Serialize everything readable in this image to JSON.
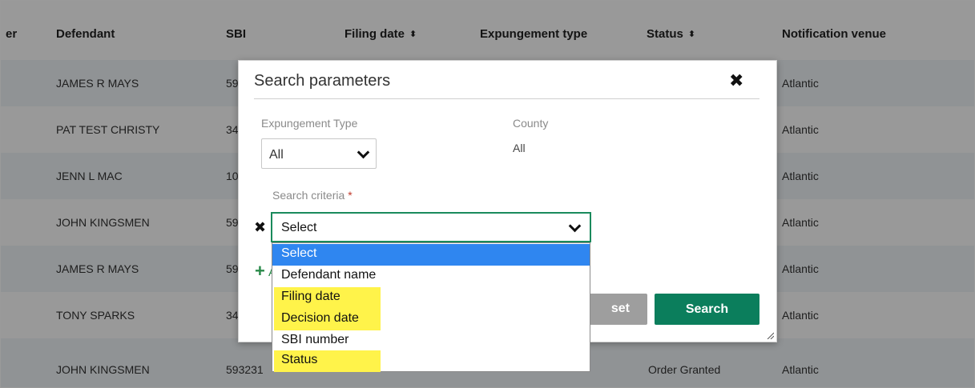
{
  "table": {
    "headers": [
      {
        "label": "er",
        "sortable": false
      },
      {
        "label": "Defendant",
        "sortable": false
      },
      {
        "label": "SBI",
        "sortable": false
      },
      {
        "label": "Filing date",
        "sortable": true
      },
      {
        "label": "Expungement type",
        "sortable": false
      },
      {
        "label": "Status",
        "sortable": true
      },
      {
        "label": "Notification venue",
        "sortable": false
      }
    ],
    "sort_icon": "⬍",
    "rows": [
      {
        "defendant": "JAMES R MAYS",
        "sbi": "59",
        "status": "",
        "venue": "Atlantic"
      },
      {
        "defendant": "PAT TEST CHRISTY",
        "sbi": "34",
        "status": "",
        "venue": "Atlantic"
      },
      {
        "defendant": "JENN L MAC",
        "sbi": "10",
        "status": "",
        "venue": "Atlantic"
      },
      {
        "defendant": "JOHN KINGSMEN",
        "sbi": "59",
        "status": "",
        "venue": "Atlantic"
      },
      {
        "defendant": "JAMES R MAYS",
        "sbi": "59",
        "status": "",
        "venue": "Atlantic"
      },
      {
        "defendant": "TONY SPARKS",
        "sbi": "34",
        "status": "",
        "venue": "Atlantic"
      },
      {
        "defendant": "JOHN KINGSMEN",
        "sbi": "593231",
        "status": "Order Granted",
        "venue": "Atlantic"
      }
    ]
  },
  "modal": {
    "title": "Search parameters",
    "close_icon": "✖",
    "expungement_type_label": "Expungement Type",
    "expungement_type_value": "All",
    "county_label": "County",
    "county_value": "All",
    "search_criteria_label": "Search criteria",
    "required_mark": "*",
    "remove_icon": "✖",
    "add_icon": "+",
    "add_label": "A",
    "reset_label": "set",
    "search_label": "Search"
  },
  "criteria_select": {
    "value": "Select",
    "options": [
      {
        "label": "Select",
        "selected": true,
        "highlight": false
      },
      {
        "label": "Defendant name",
        "selected": false,
        "highlight": false
      },
      {
        "label": "Filing date",
        "selected": false,
        "highlight": true
      },
      {
        "label": "Decision date",
        "selected": false,
        "highlight": true
      },
      {
        "label": "SBI number",
        "selected": false,
        "highlight": false
      },
      {
        "label": "Status",
        "selected": false,
        "highlight": true
      }
    ]
  },
  "colors": {
    "accent": "#0b7e5c",
    "select_border": "#1a8a5c",
    "option_selected": "#2f86f0",
    "option_highlight": "#fff34a",
    "reset_bg": "#9e9e9e"
  }
}
